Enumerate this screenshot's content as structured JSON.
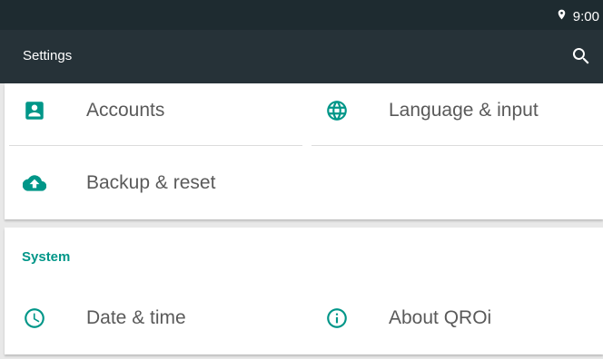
{
  "status_bar": {
    "time": "9:00",
    "location_icon": "location-pin-icon"
  },
  "app_bar": {
    "title": "Settings",
    "search_icon": "search-icon"
  },
  "card1": {
    "items": [
      {
        "label": "Accounts",
        "icon": "account-box-icon"
      },
      {
        "label": "Language & input",
        "icon": "globe-icon"
      },
      {
        "label": "Backup & reset",
        "icon": "cloud-upload-icon"
      }
    ]
  },
  "system": {
    "header": "System",
    "items": [
      {
        "label": "Date & time",
        "icon": "clock-icon"
      },
      {
        "label": "About QROi",
        "icon": "info-icon"
      }
    ]
  },
  "colors": {
    "accent": "#009688",
    "app_bar": "#263238",
    "status_bar": "#1e2b30"
  }
}
